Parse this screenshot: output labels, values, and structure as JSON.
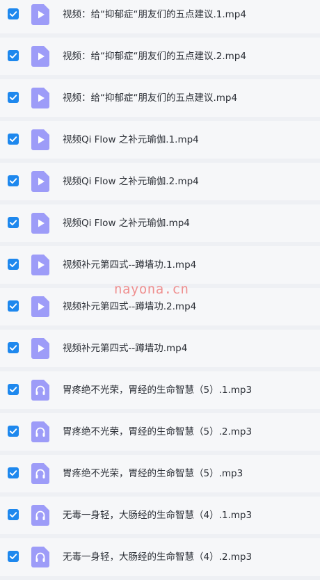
{
  "files": [
    {
      "name": "视频：给“抑郁症“朋友们的五点建议.1.mp4",
      "type": "video",
      "checked": true
    },
    {
      "name": "视频：给“抑郁症“朋友们的五点建议.2.mp4",
      "type": "video",
      "checked": true
    },
    {
      "name": "视频：给“抑郁症“朋友们的五点建议.mp4",
      "type": "video",
      "checked": true
    },
    {
      "name": "视频Qi Flow 之补元瑜伽.1.mp4",
      "type": "video",
      "checked": true
    },
    {
      "name": "视频Qi Flow 之补元瑜伽.2.mp4",
      "type": "video",
      "checked": true
    },
    {
      "name": "视频Qi Flow 之补元瑜伽.mp4",
      "type": "video",
      "checked": true
    },
    {
      "name": "视频补元第四式--蹲墙功.1.mp4",
      "type": "video",
      "checked": true
    },
    {
      "name": "视频补元第四式--蹲墙功.2.mp4",
      "type": "video",
      "checked": true
    },
    {
      "name": "视频补元第四式--蹲墙功.mp4",
      "type": "video",
      "checked": true
    },
    {
      "name": "胃疼绝不光荣，胃经的生命智慧（5）.1.mp3",
      "type": "audio",
      "checked": true
    },
    {
      "name": "胃疼绝不光荣，胃经的生命智慧（5）.2.mp3",
      "type": "audio",
      "checked": true
    },
    {
      "name": "胃疼绝不光荣，胃经的生命智慧（5）.mp3",
      "type": "audio",
      "checked": true
    },
    {
      "name": "无毒一身轻，大肠经的生命智慧（4）.1.mp3",
      "type": "audio",
      "checked": true
    },
    {
      "name": "无毒一身轻，大肠经的生命智慧（4）.2.mp3",
      "type": "audio",
      "checked": true
    }
  ],
  "icons": {
    "video": "video-file-icon",
    "audio": "audio-file-icon",
    "checkbox": "checkbox-checked-icon"
  },
  "colors": {
    "checkbox": "#1e88ee",
    "file_icon": "#9d9cf8",
    "row_bg": "#f6f7f9",
    "separator": "#eef0f4"
  },
  "watermark": "nayona.cn"
}
